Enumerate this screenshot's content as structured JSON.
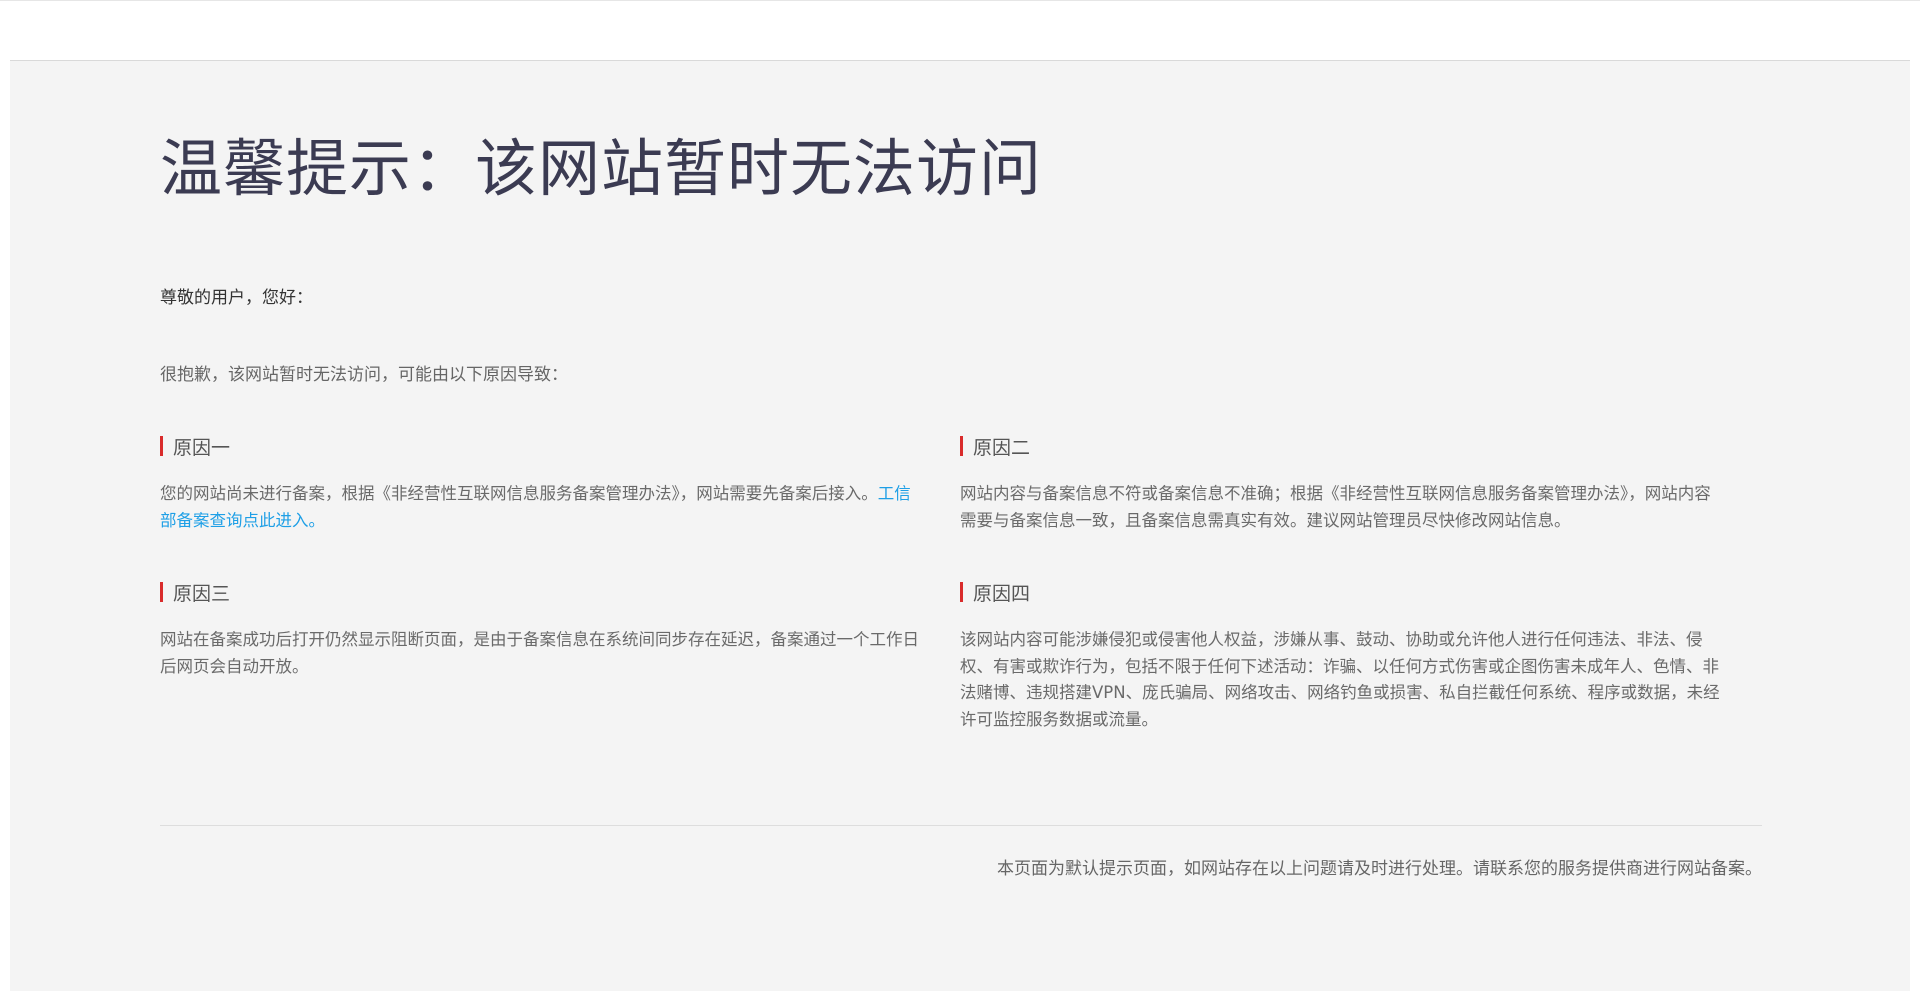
{
  "page": {
    "title": "温馨提示：该网站暂时无法访问",
    "greeting": "尊敬的用户，您好：",
    "intro": "很抱歉，该网站暂时无法访问，可能由以下原因导致：",
    "reasons": [
      {
        "title": "原因一",
        "text": "您的网站尚未进行备案，根据《非经营性互联网信息服务备案管理办法》，网站需要先备案后接入。",
        "link": "工信部备案查询点此进入。"
      },
      {
        "title": "原因二",
        "text": "网站内容与备案信息不符或备案信息不准确；根据《非经营性互联网信息服务备案管理办法》，网站内容需要与备案信息一致，且备案信息需真实有效。建议网站管理员尽快修改网站信息。"
      },
      {
        "title": "原因三",
        "text": "网站在备案成功后打开仍然显示阻断页面，是由于备案信息在系统间同步存在延迟，备案通过一个工作日后网页会自动开放。"
      },
      {
        "title": "原因四",
        "text": "该网站内容可能涉嫌侵犯或侵害他人权益，涉嫌从事、鼓动、协助或允许他人进行任何违法、非法、侵权、有害或欺诈行为，包括不限于任何下述活动：诈骗、以任何方式伤害或企图伤害未成年人、色情、非法赌博、违规搭建VPN、庞氏骗局、网络攻击、网络钓鱼或损害、私自拦截任何系统、程序或数据，未经许可监控服务数据或流量。"
      }
    ],
    "footer": "本页面为默认提示页面，如网站存在以上问题请及时进行处理。请联系您的服务提供商进行网站备案。"
  },
  "colors": {
    "accent_bar": "#d92b2b",
    "link": "#1e9fe6",
    "title": "#3b3b52",
    "panel_bg": "#f4f4f4"
  }
}
